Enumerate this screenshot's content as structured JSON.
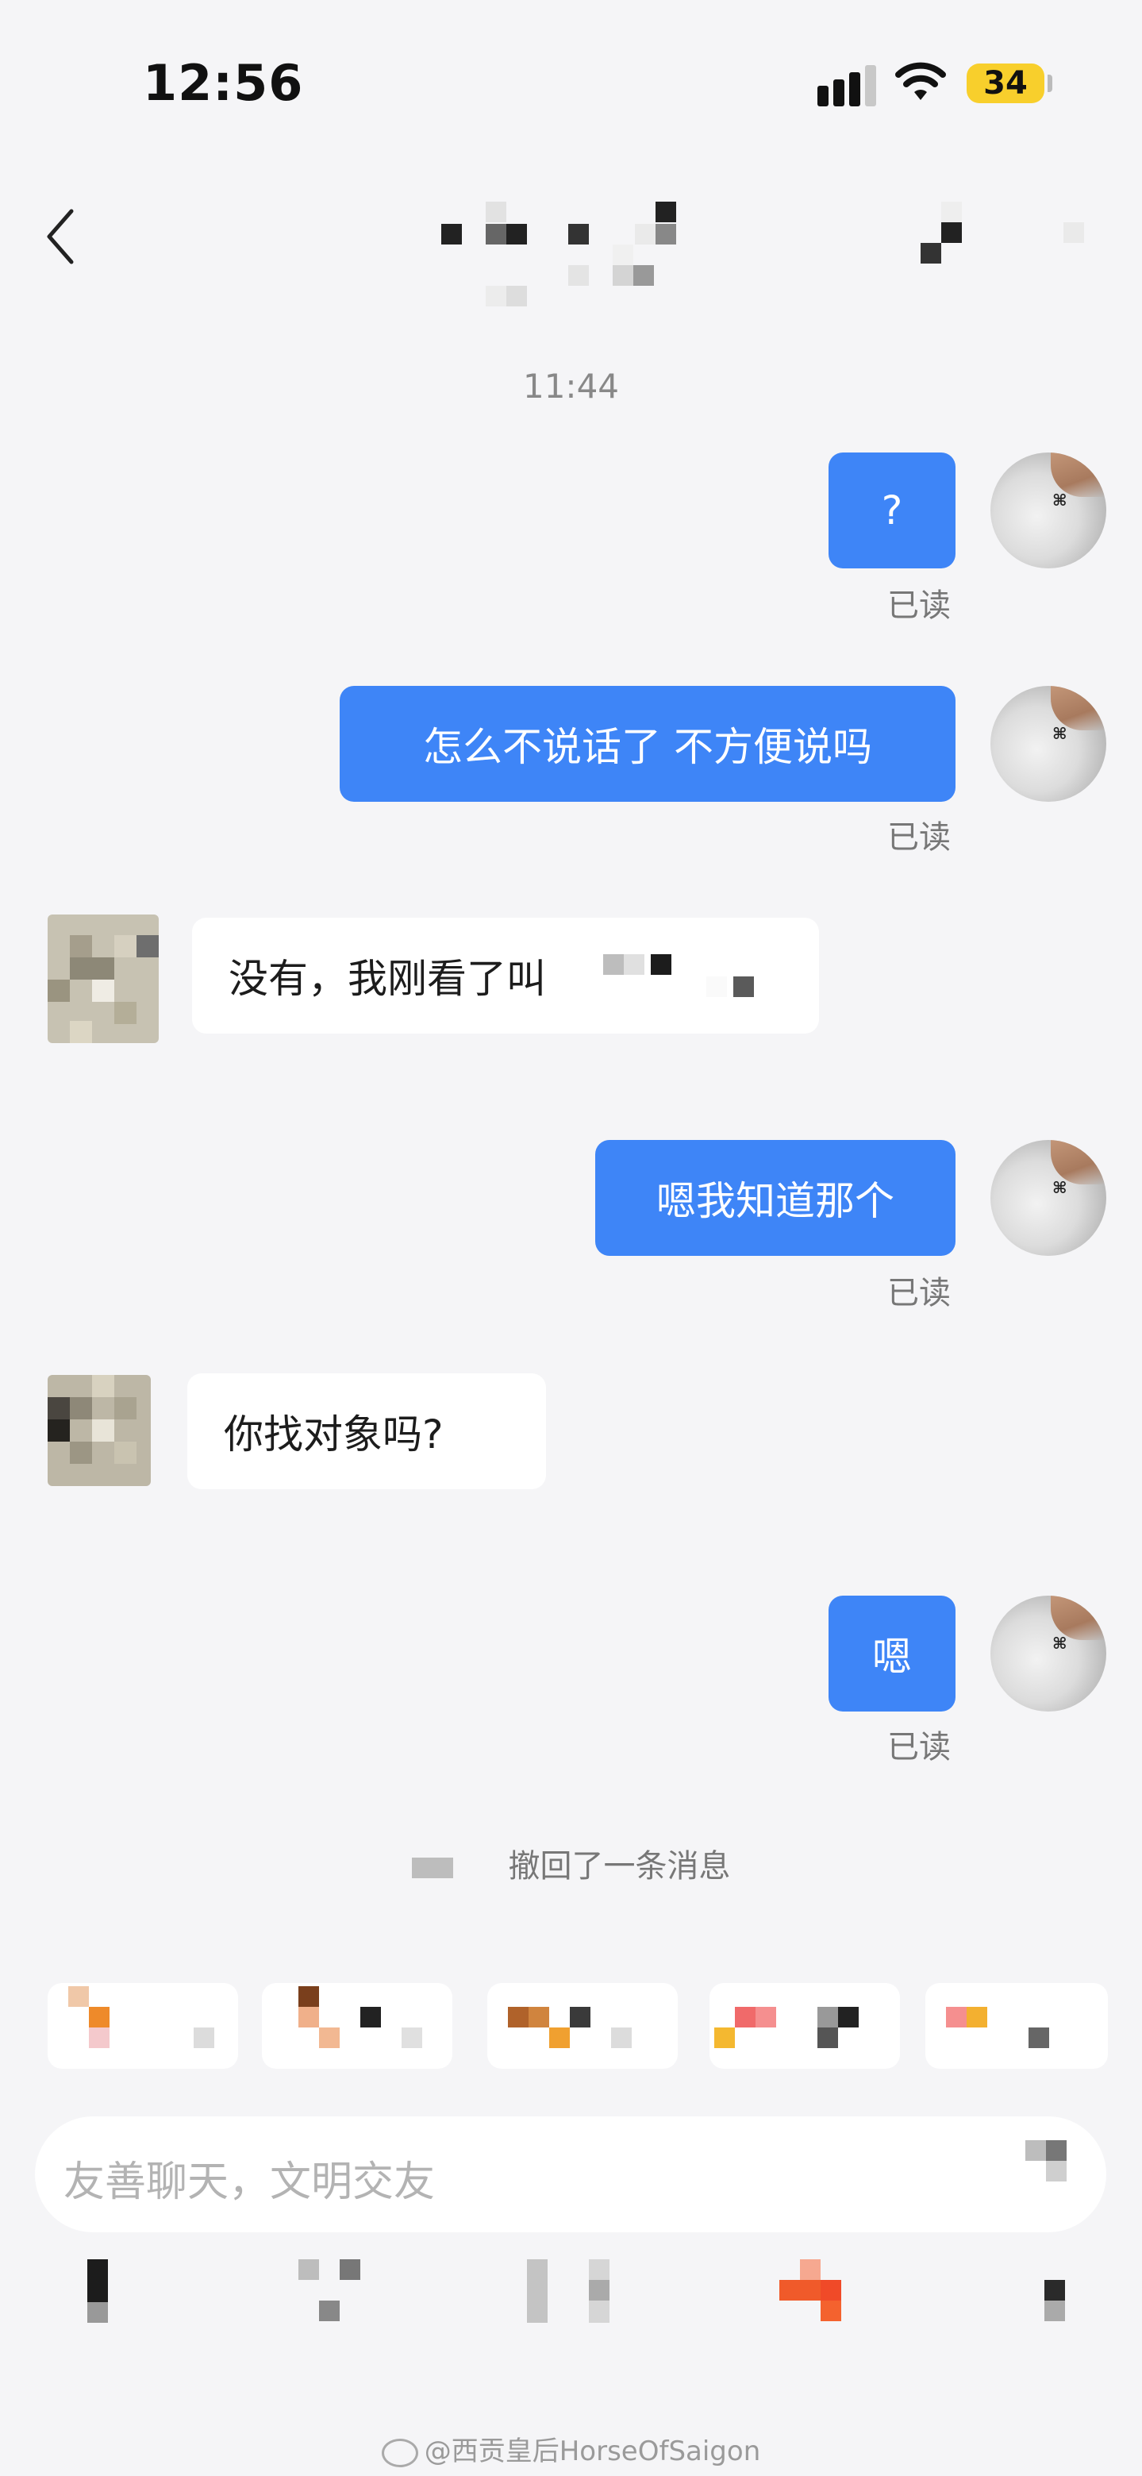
{
  "status_bar": {
    "time": "12:56",
    "battery": "34"
  },
  "chat": {
    "timestamp": "11:44",
    "messages": [
      {
        "dir": "out",
        "text": "?",
        "status": "已读"
      },
      {
        "dir": "out",
        "text": "怎么不说话了  不方便说吗",
        "status": "已读"
      },
      {
        "dir": "in",
        "text": "没有，我刚看了叫"
      },
      {
        "dir": "out",
        "text": "嗯我知道那个",
        "status": "已读"
      },
      {
        "dir": "in",
        "text": "你找对象吗?"
      },
      {
        "dir": "out",
        "text": "嗯",
        "status": "已读"
      }
    ],
    "system_message": "撤回了一条消息"
  },
  "input": {
    "placeholder": "友善聊天，文明交友"
  },
  "watermark": "@西贡皇后HorseOfSaigon",
  "icons": [
    "back-icon",
    "signal-icon",
    "wifi-icon",
    "battery-icon",
    "weibo-icon"
  ],
  "colors": {
    "outgoing_bubble": "#3e85f7",
    "incoming_bubble": "#ffffff",
    "background": "#f5f5f7",
    "battery": "#f8cf2c"
  }
}
